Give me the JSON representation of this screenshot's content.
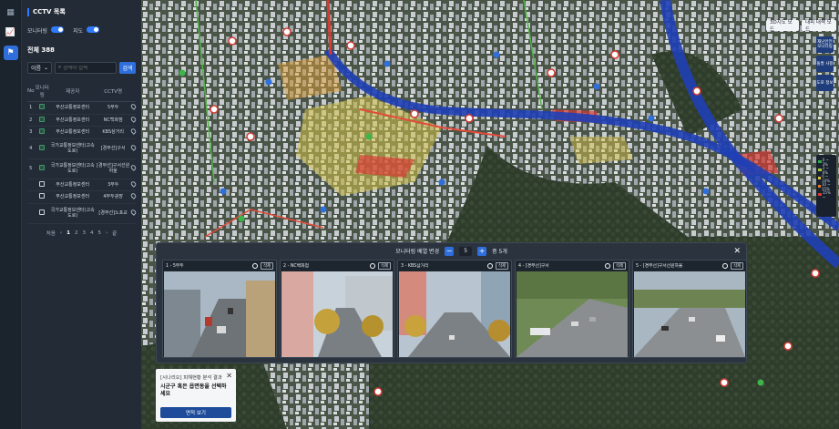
{
  "rail": {
    "icons": [
      "grid-icon",
      "chart-icon",
      "map-icon"
    ]
  },
  "panel": {
    "title": "CCTV 목록",
    "toggle_monitoring": "모니터링",
    "toggle_map": "지도",
    "total": "전체 388",
    "select_value": "이름",
    "search_placeholder": "검색어 입력",
    "search_btn": "검색",
    "columns": [
      "No",
      "모니터링",
      "제공자",
      "CCTV명"
    ],
    "rows": [
      {
        "no": "1",
        "provider": "부산교통정보센터",
        "name": "5부두",
        "on": true
      },
      {
        "no": "2",
        "provider": "부산교통정보센터",
        "name": "NC백화점",
        "on": true
      },
      {
        "no": "3",
        "provider": "부산교통정보센터",
        "name": "KBS삼거리",
        "on": true
      },
      {
        "no": "4",
        "provider": "국가교통정보센터(고속도로)",
        "name": "[경부선]구서",
        "on": true
      },
      {
        "no": "5",
        "provider": "국가교통정보센터(고속도로)",
        "name": "[경부선]구서선원하울",
        "on": true
      },
      {
        "no": "",
        "provider": "부산교통정보센터",
        "name": "3부두",
        "on": false
      },
      {
        "no": "",
        "provider": "부산교통정보센터",
        "name": "4부두광장",
        "on": false
      },
      {
        "no": "",
        "provider": "국가교통정보센터(고속도로)",
        "name": "[경부선]노포교",
        "on": false
      }
    ],
    "pager": {
      "label": "처음",
      "pages": [
        "1",
        "2",
        "3",
        "4",
        "5"
      ],
      "end": "끝"
    }
  },
  "map": {
    "btn_3d": "3D지도 모드",
    "btn_label": "대피 대책 모드",
    "side_tools": [
      "재난안전 모니터링",
      "돌발 사항",
      "도로 정보"
    ],
    "legend": [
      "0 ~ 3%",
      "3 ~ 6%",
      "6 ~ 10%",
      "10 ~ 15%",
      "15% ~"
    ]
  },
  "monitor": {
    "header": "모니터링 배열 변경",
    "count": "5",
    "suffix": "중 5개",
    "cams": [
      {
        "label": "1 - 5부두"
      },
      {
        "label": "2 - NC백화점"
      },
      {
        "label": "3 - KBS삼거리"
      },
      {
        "label": "4 - [경부선]구서"
      },
      {
        "label": "5 - [경부선]구서선원하울"
      }
    ],
    "delete": "삭제"
  },
  "card": {
    "line1": "[시나리오] 피해현황 분석 결과",
    "line2": "시군구 혹은 읍면동을 선택하세요",
    "button": "면적 보기"
  },
  "colors": {
    "accent": "#2f6fdc",
    "road": "#1f3fb5"
  }
}
